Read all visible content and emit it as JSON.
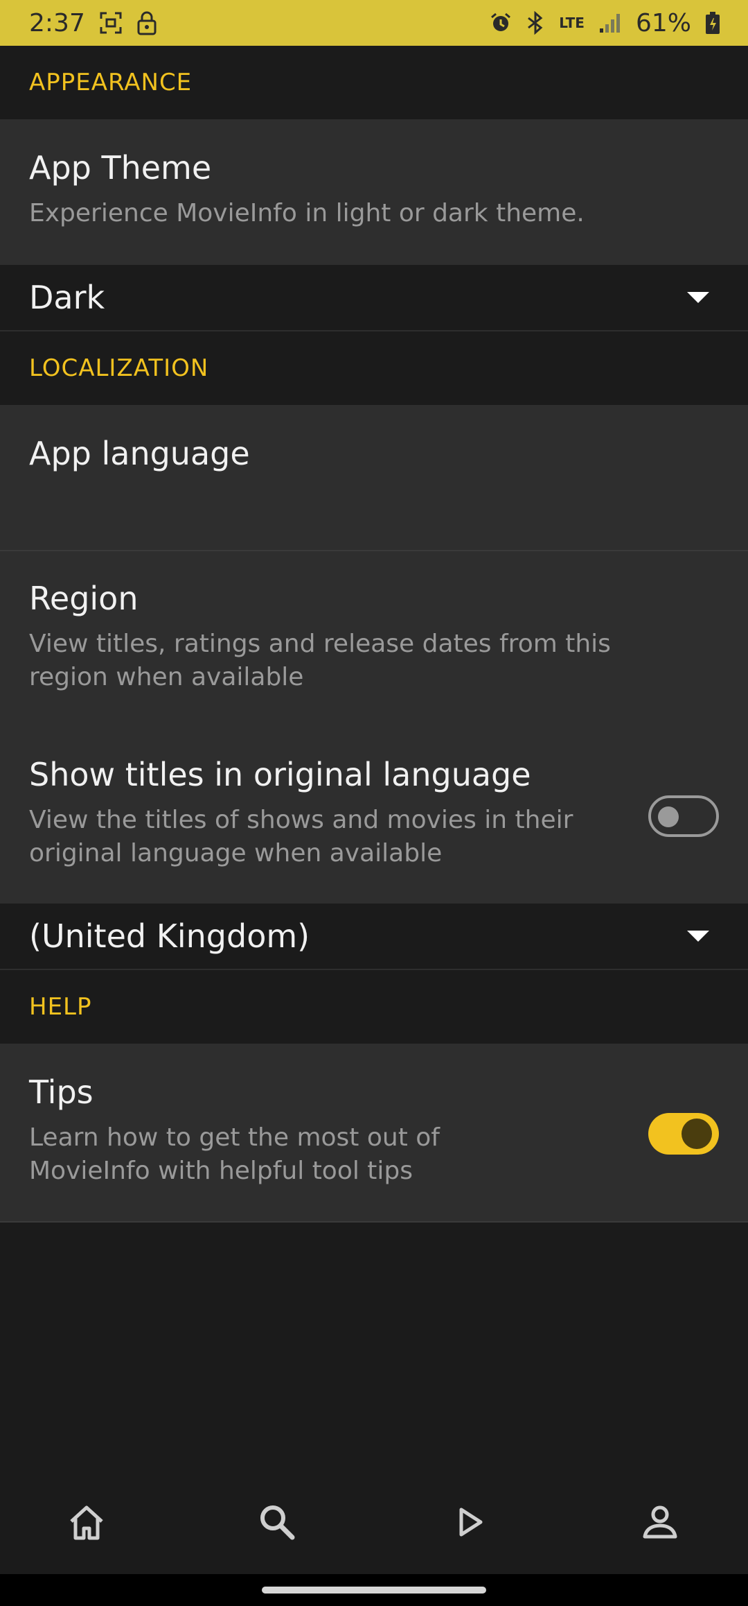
{
  "status_bar": {
    "time": "2:37",
    "battery": "61%",
    "network": "LTE",
    "icons": [
      "screenshot-icon",
      "lock-icon",
      "alarm-icon",
      "bluetooth-icon",
      "lte-icon",
      "signal-icon",
      "battery-icon"
    ]
  },
  "sections": {
    "appearance": {
      "header": "APPEARANCE",
      "app_theme": {
        "title": "App Theme",
        "summary": "Experience MovieInfo in light or dark theme.",
        "dropdown_value": "Dark"
      }
    },
    "localization": {
      "header": "LOCALIZATION",
      "app_language": {
        "title": "App language"
      },
      "region": {
        "title": "Region",
        "summary": "View titles, ratings and release dates from this region when available"
      },
      "original_titles": {
        "title": "Show titles in original language",
        "summary": "View the titles of shows and movies in their original language when available",
        "enabled": false
      },
      "region_dropdown_value": "(United Kingdom)"
    },
    "help": {
      "header": "HELP",
      "tips": {
        "title": "Tips",
        "summary": "Learn how to get the most out of MovieInfo with helpful tool tips",
        "enabled": true
      }
    }
  },
  "bottom_nav": {
    "items": [
      "home-icon",
      "search-icon",
      "play-icon",
      "profile-icon"
    ]
  },
  "colors": {
    "accent": "#f2c21f",
    "status_bar": "#d9c43a",
    "background": "#1b1b1b",
    "card": "#2e2e2e"
  }
}
